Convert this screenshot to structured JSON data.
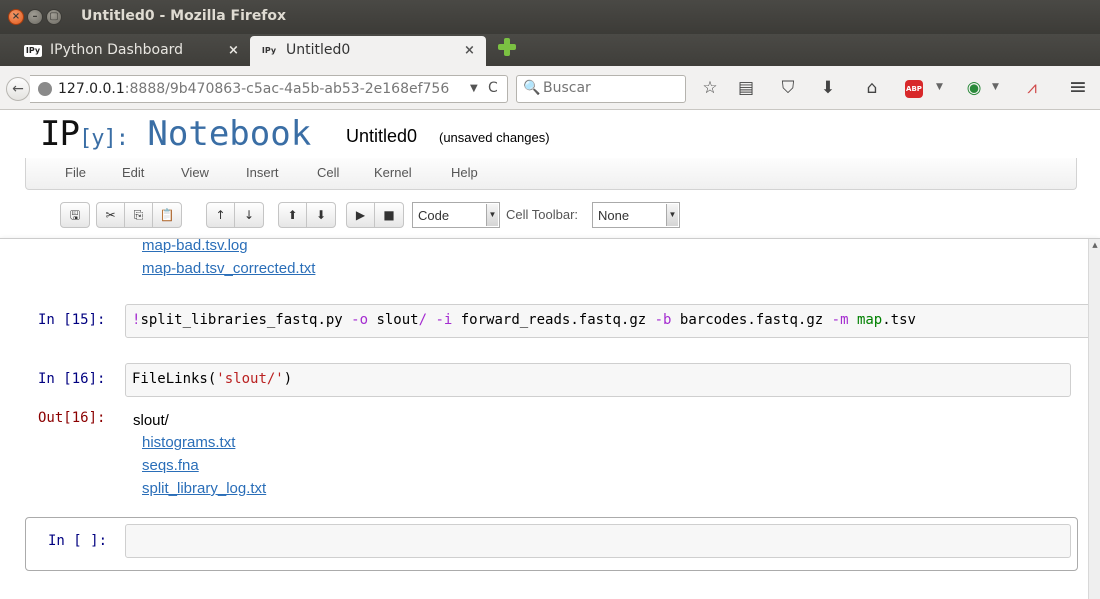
{
  "window": {
    "title": "Untitled0 - Mozilla Firefox",
    "close_glyph": "×",
    "min_glyph": "–",
    "max_glyph": "▢"
  },
  "tabs": [
    {
      "label": "IPython Dashboard",
      "favicon": "IPy",
      "active": false,
      "close": "×"
    },
    {
      "label": "Untitled0",
      "favicon": "IPy",
      "active": true,
      "close": "×"
    }
  ],
  "navbar": {
    "url_host": "127.0.0.1",
    "url_rest": ":8888/9b470863-c5ac-4a5b-ab53-2e168ef756",
    "search_placeholder": "Buscar",
    "icons": [
      "back-icon",
      "globe-icon",
      "dropdown-icon",
      "reload-icon",
      "search-icon",
      "bookmark-star-icon",
      "reading-list-icon",
      "pocket-icon",
      "download-icon",
      "home-icon",
      "adblock-icon",
      "globe-addon-icon",
      "chart-icon",
      "hamburger-menu-icon"
    ],
    "glyphs": {
      "back": "←",
      "drop": "▼",
      "reload": "C",
      "search": "🔍",
      "star": "☆",
      "list": "▤",
      "pocket": "⛉",
      "download": "⬇",
      "home": "⌂",
      "abp": "ABP",
      "menu": "≡",
      "chart": "⩘",
      "globe": "◉"
    }
  },
  "notebook_header": {
    "logo_ip": "IP",
    "logo_bracket": "[y]:",
    "logo_text": "Notebook",
    "name": "Untitled0",
    "status": "(unsaved changes)"
  },
  "menu": [
    "File",
    "Edit",
    "View",
    "Insert",
    "Cell",
    "Kernel",
    "Help"
  ],
  "toolbar": {
    "glyphs": {
      "save": "🖫",
      "cut": "✂",
      "copy": "⎘",
      "paste": "📋",
      "up": "↑",
      "down": "↓",
      "run_up": "⬆",
      "run_down": "⬇",
      "run": "▶",
      "stop": "■"
    },
    "cell_type": "Code",
    "cell_toolbar_label": "Cell Toolbar:",
    "cell_toolbar_value": "None",
    "select_arrow": "▼"
  },
  "cells": {
    "prev_links": [
      "map-bad.tsv.log",
      "map-bad.tsv_corrected.txt"
    ],
    "cell15": {
      "prompt": "In [15]:",
      "code": {
        "bang": "!",
        "cmd": "split_libraries_fastq.py ",
        "o_flag": "-o",
        "o_arg": " slout",
        "slash": "/",
        "i_flag": "-i",
        "i_arg": " forward_reads.fastq.gz ",
        "b_flag": "-b",
        "b_arg": " barcodes.fastq.gz ",
        "m_flag": "-m",
        "m_map": "map",
        "m_ext": ".tsv"
      }
    },
    "cell16": {
      "prompt": "In [16]:",
      "code_fn": "FileLinks",
      "code_open": "(",
      "code_str": "'slout/'",
      "code_close": ")",
      "out_prompt": "Out[16]:",
      "out_dir": "slout/",
      "out_links": [
        "histograms.txt",
        "seqs.fna",
        "split_library_log.txt"
      ]
    },
    "empty_cell": {
      "prompt": "In [ ]:"
    }
  },
  "scrollbar": {
    "up_glyph": "▲"
  }
}
